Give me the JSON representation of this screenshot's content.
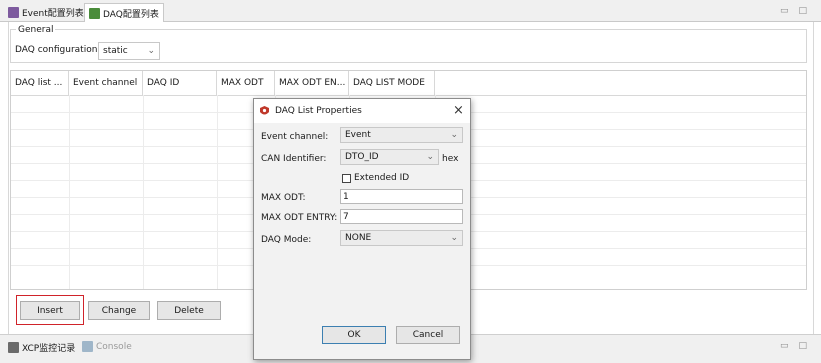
{
  "tabs": [
    {
      "label": "Event配置列表",
      "icon": "event-list-icon",
      "active": false
    },
    {
      "label": "DAQ配置列表",
      "icon": "daq-list-icon",
      "active": true
    }
  ],
  "window_controls": {
    "minimize": "▭",
    "maximize": "□"
  },
  "general": {
    "title": "General",
    "daq_config_label": "DAQ configuration:",
    "daq_config_value": "static"
  },
  "table": {
    "columns": [
      "DAQ list ...",
      "Event channel",
      "DAQ ID",
      "MAX ODT",
      "MAX ODT EN...",
      "DAQ LIST MODE"
    ],
    "rows": []
  },
  "buttons": {
    "insert": "Insert",
    "change": "Change",
    "delete": "Delete"
  },
  "bottom_tabs": [
    {
      "label": "XCP监控记录",
      "icon": "xcp-monitor-icon"
    },
    {
      "label": "Console",
      "icon": "console-icon"
    }
  ],
  "dialog": {
    "title": "DAQ List Properties",
    "close": "×",
    "event_channel_label": "Event channel:",
    "event_channel_value": "Event",
    "can_identifier_label": "CAN Identifier:",
    "can_identifier_value": "DTO_ID",
    "hex_label": "hex",
    "extended_id_label": "Extended ID",
    "extended_id_checked": false,
    "max_odt_label": "MAX ODT:",
    "max_odt_value": "1",
    "max_odt_entry_label": "MAX ODT ENTRY:",
    "max_odt_entry_value": "7",
    "daq_mode_label": "DAQ Mode:",
    "daq_mode_value": "NONE",
    "ok": "OK",
    "cancel": "Cancel"
  },
  "colors": {
    "highlight": "#d0232a",
    "app_icon": "#c0392b",
    "tab_icon_green": "#4a8c3a"
  }
}
